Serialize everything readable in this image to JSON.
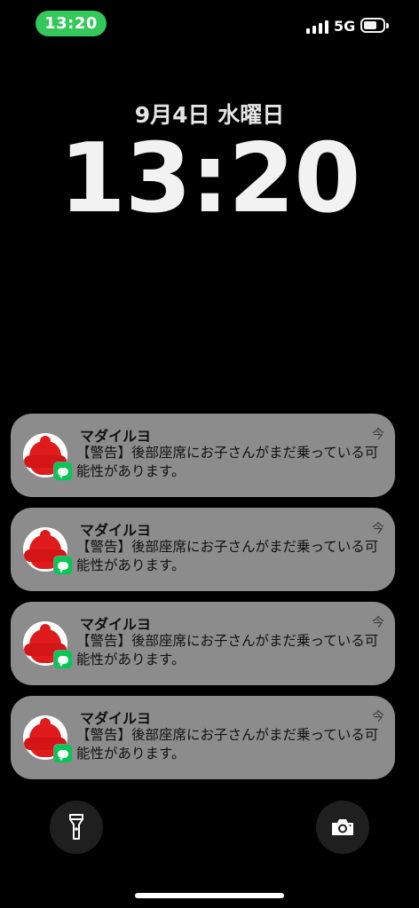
{
  "status_bar": {
    "time": "13:20",
    "network": "5G",
    "time_pill_color": "#34c759",
    "battery_level": 0.7,
    "signal_icon": "signal-bars-icon",
    "battery_icon": "battery-icon"
  },
  "lock_screen": {
    "date": "9月4日 水曜日",
    "time": "13:20"
  },
  "notifications": [
    {
      "sender": "マダイルヨ",
      "time": "今",
      "message": "【警告】後部座席にお子さんがまだ乗っている可能性があります。",
      "app_icon": "line-app-icon",
      "avatar": "red-figure-avatar"
    },
    {
      "sender": "マダイルヨ",
      "time": "今",
      "message": "【警告】後部座席にお子さんがまだ乗っている可能性があります。",
      "app_icon": "line-app-icon",
      "avatar": "red-figure-avatar"
    },
    {
      "sender": "マダイルヨ",
      "time": "今",
      "message": "【警告】後部座席にお子さんがまだ乗っている可能性があります。",
      "app_icon": "line-app-icon",
      "avatar": "red-figure-avatar"
    },
    {
      "sender": "マダイルヨ",
      "time": "今",
      "message": "【警告】後部座席にお子さんがまだ乗っている可能性があります。",
      "app_icon": "line-app-icon",
      "avatar": "red-figure-avatar"
    }
  ],
  "quick_actions": {
    "left_icon": "flashlight-icon",
    "right_icon": "camera-icon"
  },
  "colors": {
    "notification_bg": "#8c8c8c",
    "line_green": "#06c755",
    "avatar_red": "#e01b1b"
  }
}
